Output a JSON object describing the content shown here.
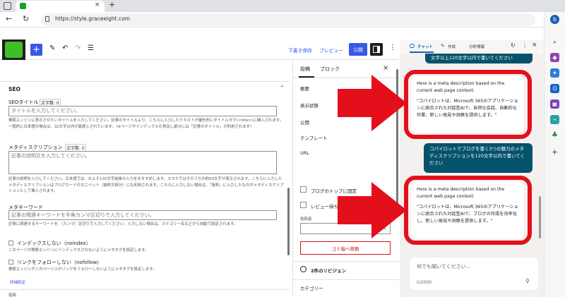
{
  "browser": {
    "url": "https://style.graceeight.com",
    "new_tab_symbol": "+",
    "close_tab_symbol": "×"
  },
  "wp_toolbar": {
    "save_draft": "下書き保存",
    "preview": "プレビュー",
    "publish": "公開"
  },
  "editor": {
    "seo_title": "SEO",
    "seo_title_field": {
      "label": "SEOタイトル",
      "counter": "文字数: 0",
      "placeholder": "タイトルを入力してください。",
      "hint": "検索エンジンに表示させたいタイトルを入力してください。記事のタイトルより、こちらに入力したテキストが優先的にタイトルタグ(<title>)に挿入されます。一般的に日本語の場合は、32文字以内が最適とされています。（※ページやインデックスの見出し部分には「記事のタイトル」が利用されます）"
    },
    "meta_description": {
      "label": "メタディスクリプション",
      "counter": "文字数: 0",
      "placeholder": "記事の説明文を入力してください。",
      "hint": "記事の説明を入力してください。日本語では、およそ120文字前後の入力をおすすめします。スマホではそのうちの約50文字が表示されます。こちらに入力したメタディスクリプションはブログカードのスニペット（抜粋文部分）にも利用されます。こちらに入力しない場合は、「抜粋」に入力したものがメタディスクリプションとして挿入されます。"
    },
    "meta_keyword": {
      "label": "メタキーワード",
      "placeholder": "記事の関連キーワードを半角カンマ区切りで入力してください。",
      "hint": "記事に関連するキーワードを,（カンマ）区切りで入力してください。入力しない場合は、カテゴリー名などから自動で設定されます。"
    },
    "noindex": {
      "label": "インデックスしない（noindex）",
      "hint": "このページが検索エンジンにインデックスされないようにメタタグを設定します。"
    },
    "nofollow": {
      "label": "リンクをフォローしない（nofollow）",
      "hint": "検索エンジンがこのページ上のリンクをフォローしないようにメタタグを設定します。"
    },
    "advanced_link": "詳細設定",
    "bottom_label": "投稿"
  },
  "settings_panel": {
    "tabs": [
      "投稿",
      "ブロック"
    ],
    "rows": [
      "概要",
      "表示状態",
      "公開",
      "テンプレート",
      "URL"
    ],
    "stick_to_top": "ブログのトップに固定",
    "pending_review": "レビュー待ち",
    "author_label": "投稿者",
    "trash_button": "ゴミ箱へ移動",
    "revisions": "2件のリビジョン",
    "categories": "カテゴリー"
  },
  "copilot": {
    "tabs": [
      "チャット",
      "作成",
      "分析情報"
    ],
    "msg_user_1_tail": "文字以上120文字以内で書いてください",
    "msg_ai_1": {
      "intro": "Here is a meta description based on the current web page context:",
      "body": "\"コパイロットは、Microsoft 365のアプリケーションに統合された対話型AIで、自然な会話、自動的な作業、新しい発見や洞察を提供します。\""
    },
    "msg_user_2": "コパイロットでブログを書く3つの魅力のメタディスクリプションを120文字以内で書いてください",
    "msg_ai_2": {
      "intro": "Here is a meta description based on the current web page context:",
      "body": "\"コパイロットは、Microsoft 365のアプリケーションに統合された対話型AIで、ブログの作成を効率化し、新しい発見や洞察を提供します。\""
    },
    "input_placeholder": "何でも聞いてください...",
    "char_counter": "0/2000"
  },
  "colors": {
    "highlight_red": "#e3101c",
    "wp_blue": "#3858e9",
    "copilot_user_bubble": "#05526b"
  }
}
